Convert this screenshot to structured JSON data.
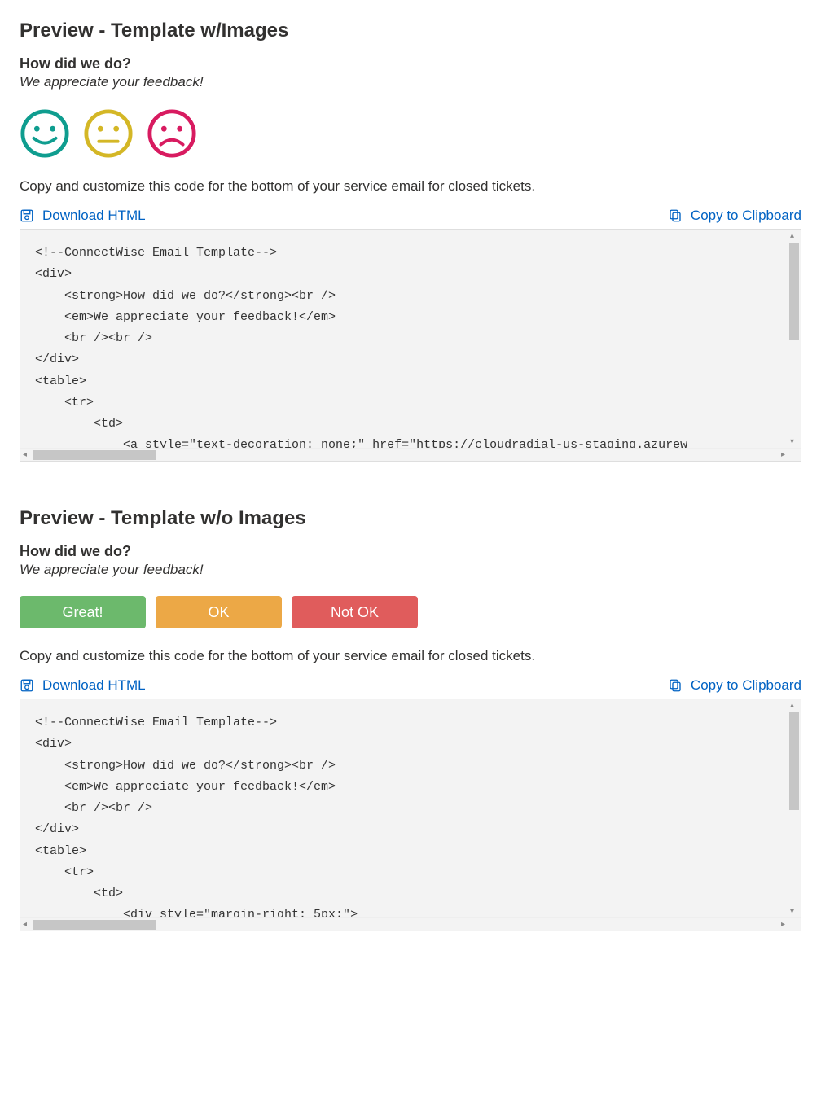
{
  "section1": {
    "title": "Preview - Template w/Images",
    "heading": "How did we do?",
    "subheading": "We appreciate your feedback!",
    "instruction": "Copy and customize this code for the bottom of your service email for closed tickets.",
    "download_label": "Download HTML",
    "copy_label": "Copy to Clipboard",
    "faces": {
      "happy_color": "#0f9d8f",
      "neutral_color": "#d4b726",
      "sad_color": "#d81b60"
    },
    "code": "<!--ConnectWise Email Template-->\n<div>\n    <strong>How did we do?</strong><br />\n    <em>We appreciate your feedback!</em>\n    <br /><br />\n</div>\n<table>\n    <tr>\n        <td>\n            <a style=\"text-decoration: none;\" href=\"https://cloudradial-us-staging.azurew"
  },
  "section2": {
    "title": "Preview - Template w/o Images",
    "heading": "How did we do?",
    "subheading": "We appreciate your feedback!",
    "instruction": "Copy and customize this code for the bottom of your service email for closed tickets.",
    "download_label": "Download HTML",
    "copy_label": "Copy to Clipboard",
    "buttons": {
      "great": "Great!",
      "ok": "OK",
      "not_ok": "Not OK"
    },
    "code": "<!--ConnectWise Email Template-->\n<div>\n    <strong>How did we do?</strong><br />\n    <em>We appreciate your feedback!</em>\n    <br /><br />\n</div>\n<table>\n    <tr>\n        <td>\n            <div style=\"margin-right: 5px;\">"
  }
}
